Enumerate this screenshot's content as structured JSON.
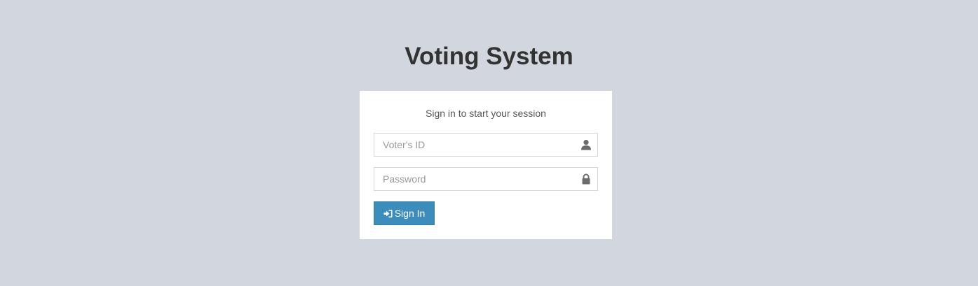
{
  "logo": {
    "title": "Voting System"
  },
  "login_box": {
    "message": "Sign in to start your session",
    "voter_id": {
      "placeholder": "Voter's ID",
      "value": "",
      "icon": "user-icon"
    },
    "password": {
      "placeholder": "Password",
      "value": "",
      "icon": "lock-icon"
    },
    "sign_in_button": {
      "label": "Sign In",
      "icon": "sign-in-icon"
    }
  },
  "colors": {
    "background": "#d2d6de",
    "button": "#3c8dbc",
    "title": "#333333"
  }
}
